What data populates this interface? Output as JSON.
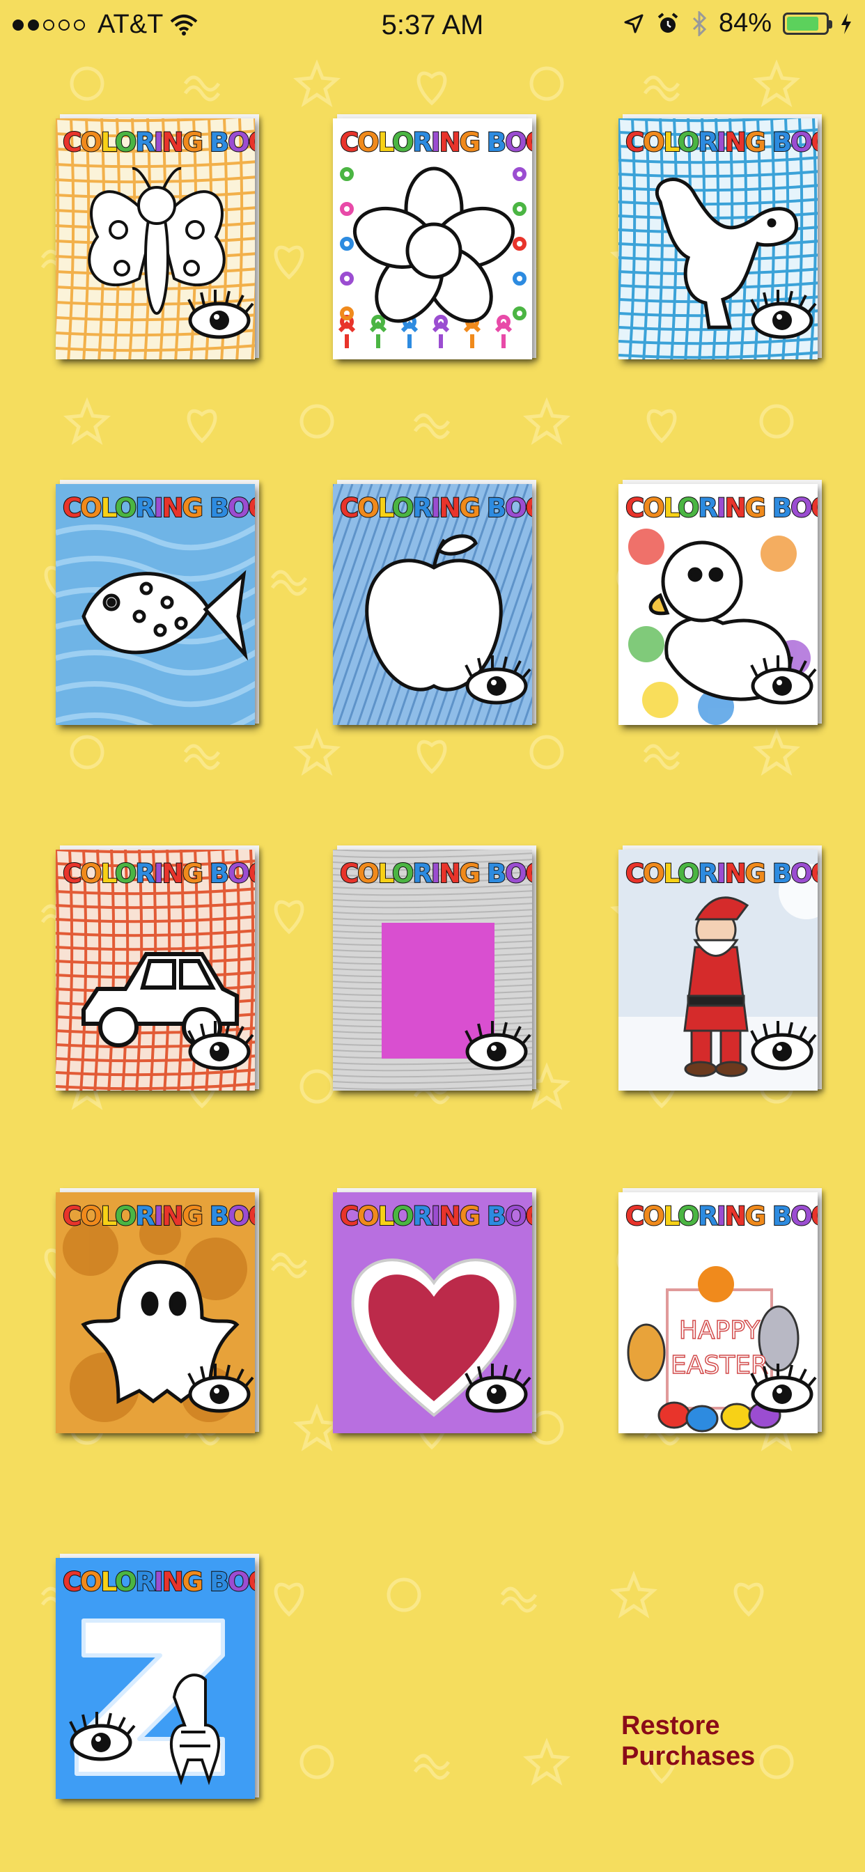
{
  "status_bar": {
    "signal_dots": [
      true,
      true,
      false,
      false,
      false
    ],
    "carrier": "AT&T",
    "time": "5:37 AM",
    "battery": "84%",
    "battery_level": 0.84
  },
  "book_title": "COLORING BOOK",
  "title_colors": [
    "#e8342b",
    "#f08a1c",
    "#f7d117",
    "#4bb543",
    "#2d8be0",
    "#9b4dd1",
    "#e8342b",
    "#f08a1c",
    "#4bb543",
    "#2d8be0",
    "#9b4dd1",
    "#e8342b",
    "#f7d117"
  ],
  "books": [
    {
      "name": "butterfly",
      "preview_icon": true
    },
    {
      "name": "flower",
      "preview_icon": false
    },
    {
      "name": "dinosaur",
      "preview_icon": true
    },
    {
      "name": "fish",
      "preview_icon": false
    },
    {
      "name": "apple",
      "preview_icon": true
    },
    {
      "name": "duck",
      "preview_icon": true
    },
    {
      "name": "car",
      "preview_icon": true
    },
    {
      "name": "blank",
      "preview_icon": true
    },
    {
      "name": "santa",
      "preview_icon": true
    },
    {
      "name": "ghost",
      "preview_icon": true
    },
    {
      "name": "heart",
      "preview_icon": true
    },
    {
      "name": "easter",
      "preview_icon": true,
      "text": "HAPPY EASTER"
    },
    {
      "name": "letter-z",
      "preview_icon": true
    }
  ],
  "restore": {
    "line1": "Restore",
    "line2": "Purchases"
  }
}
